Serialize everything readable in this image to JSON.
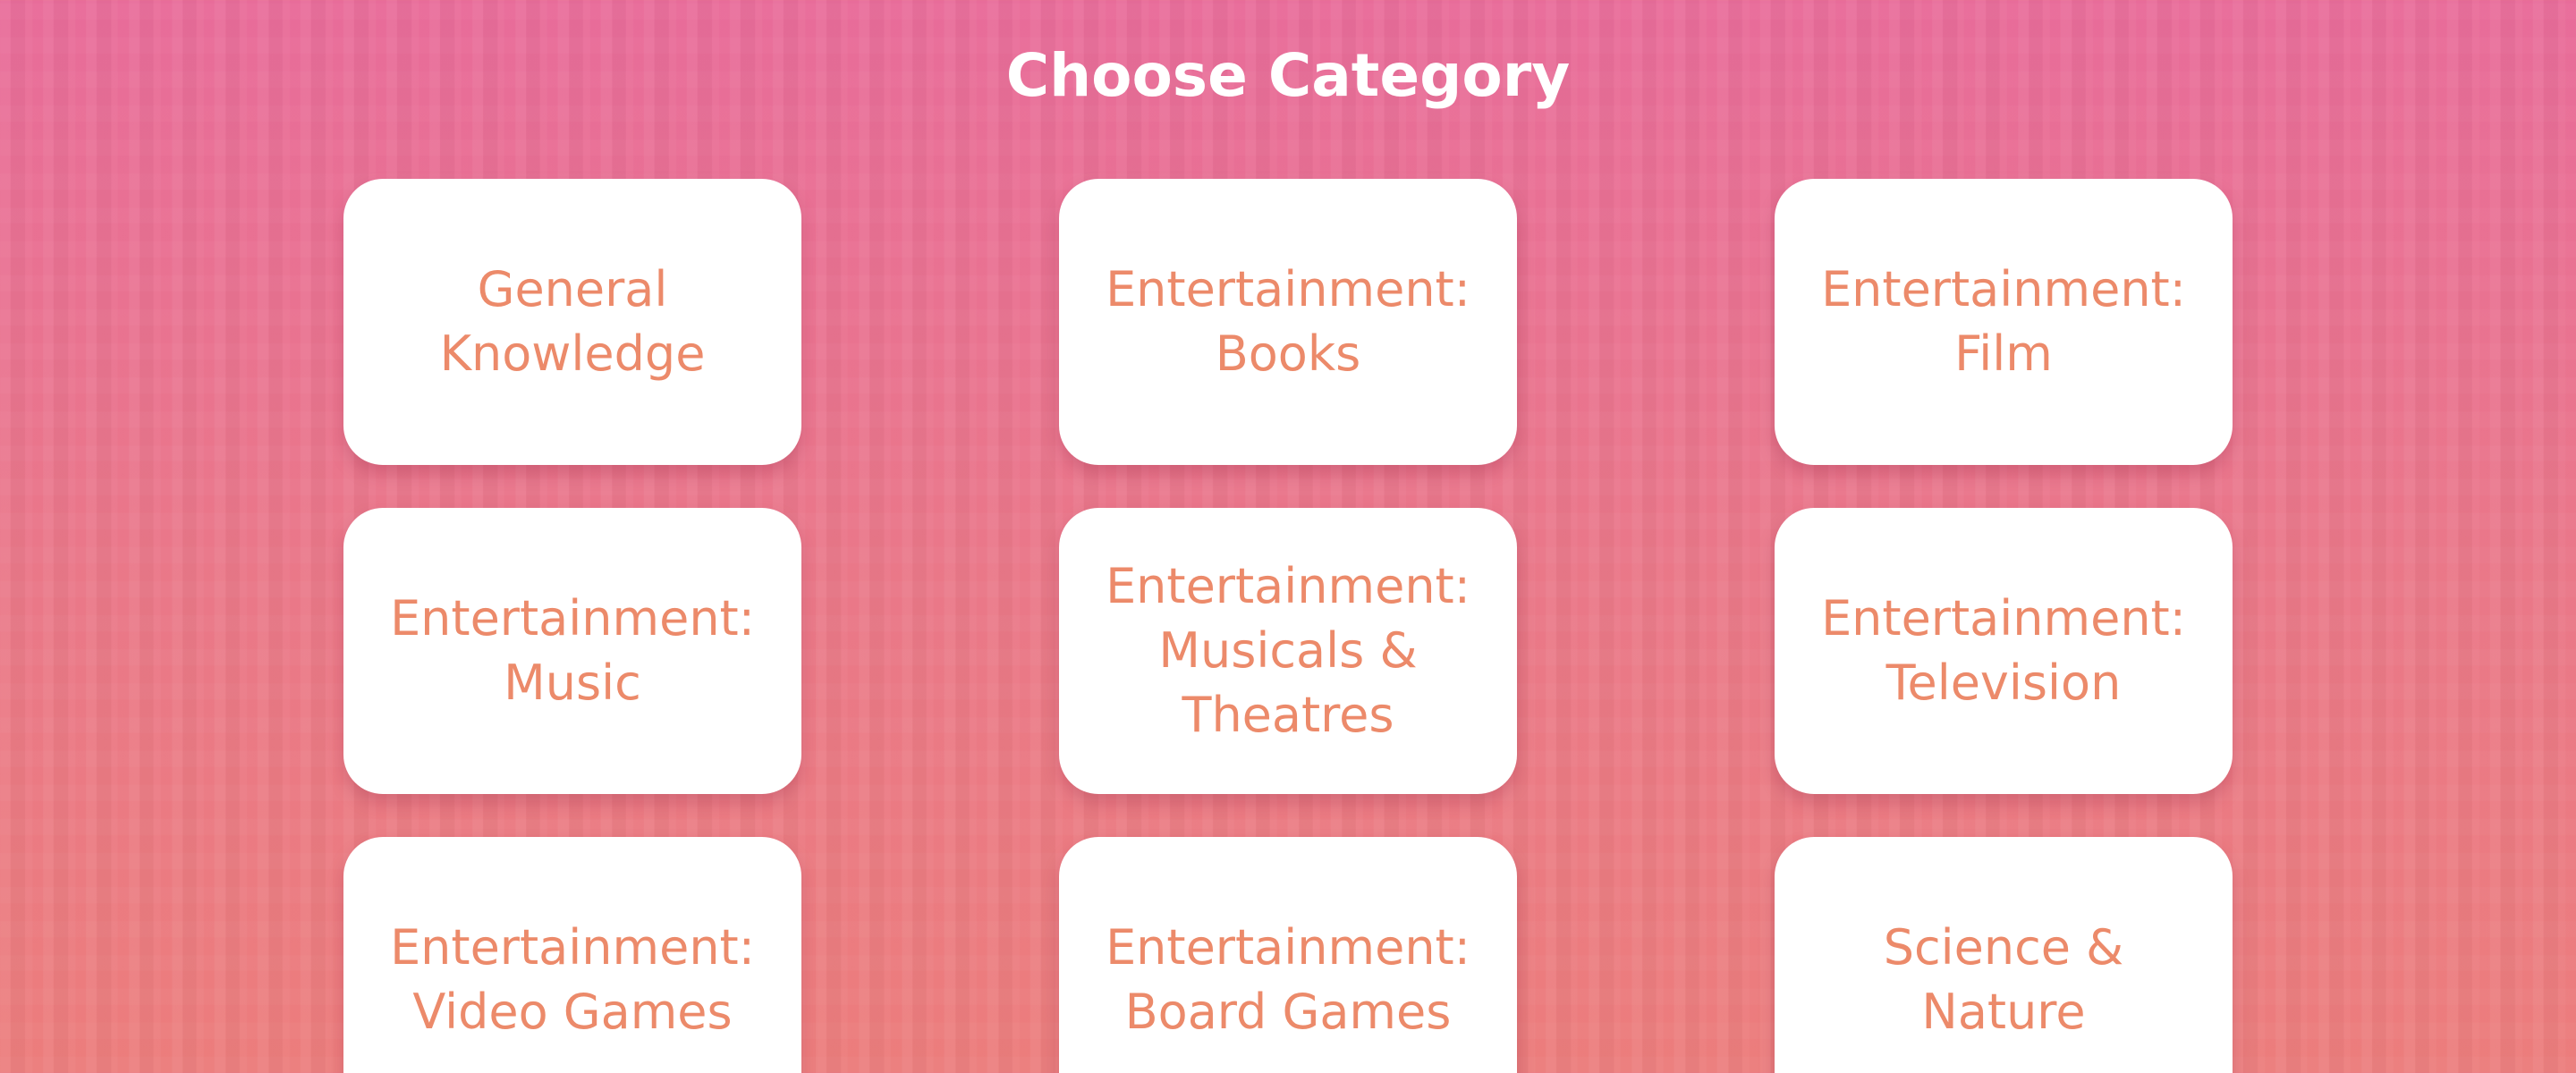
{
  "header": {
    "title": "Choose Category"
  },
  "colors": {
    "background_top": "#e86c9a",
    "background_bottom": "#ec7d7c",
    "card_background": "#ffffff",
    "card_text": "#ec8a6a",
    "title_text": "#ffffff"
  },
  "categories": [
    {
      "label": "General\nKnowledge"
    },
    {
      "label": "Entertainment:\nBooks"
    },
    {
      "label": "Entertainment:\nFilm"
    },
    {
      "label": "Entertainment:\nMusic"
    },
    {
      "label": "Entertainment:\nMusicals &\nTheatres"
    },
    {
      "label": "Entertainment:\nTelevision"
    },
    {
      "label": "Entertainment:\nVideo Games"
    },
    {
      "label": "Entertainment:\nBoard Games"
    },
    {
      "label": "Science &\nNature"
    }
  ]
}
